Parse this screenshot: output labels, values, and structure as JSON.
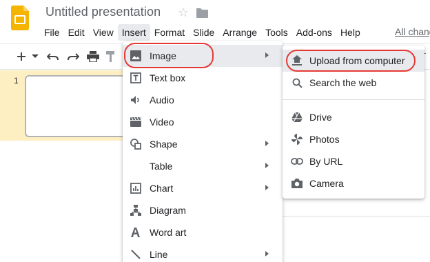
{
  "app": {
    "title": "Untitled presentation",
    "all_changes": "All chang"
  },
  "menubar": [
    "File",
    "Edit",
    "View",
    "Insert",
    "Format",
    "Slide",
    "Arrange",
    "Tools",
    "Add-ons",
    "Help"
  ],
  "toolbar": {
    "icons": [
      "add-icon",
      "dropdown-arrow-icon",
      "undo-icon",
      "redo-icon",
      "print-icon",
      "paint-format-icon"
    ],
    "right_text": "T"
  },
  "filmstrip": {
    "slide_number": "1"
  },
  "insert_menu": {
    "items": [
      {
        "label": "Image",
        "icon": "image-icon",
        "submenu": true
      },
      {
        "label": "Text box",
        "icon": "text-box-icon",
        "submenu": false
      },
      {
        "label": "Audio",
        "icon": "audio-icon",
        "submenu": false
      },
      {
        "label": "Video",
        "icon": "video-icon",
        "submenu": false
      },
      {
        "label": "Shape",
        "icon": "shape-icon",
        "submenu": true
      },
      {
        "label": "Table",
        "icon": "",
        "submenu": true
      },
      {
        "label": "Chart",
        "icon": "chart-icon",
        "submenu": true
      },
      {
        "label": "Diagram",
        "icon": "diagram-icon",
        "submenu": false
      },
      {
        "label": "Word art",
        "icon": "word-art-icon",
        "submenu": false
      },
      {
        "label": "Line",
        "icon": "line-icon",
        "submenu": true
      }
    ]
  },
  "image_submenu": {
    "items": [
      {
        "label": "Upload from computer",
        "icon": "upload-icon"
      },
      {
        "label": "Search the web",
        "icon": "search-icon"
      },
      {
        "label": "Drive",
        "icon": "drive-icon"
      },
      {
        "label": "Photos",
        "icon": "photos-icon"
      },
      {
        "label": "By URL",
        "icon": "link-icon"
      },
      {
        "label": "Camera",
        "icon": "camera-icon"
      }
    ]
  },
  "colors": {
    "highlight_oval": "#e53935",
    "logo_yellow": "#f4b400",
    "filmstrip_selected": "#feefc3"
  }
}
